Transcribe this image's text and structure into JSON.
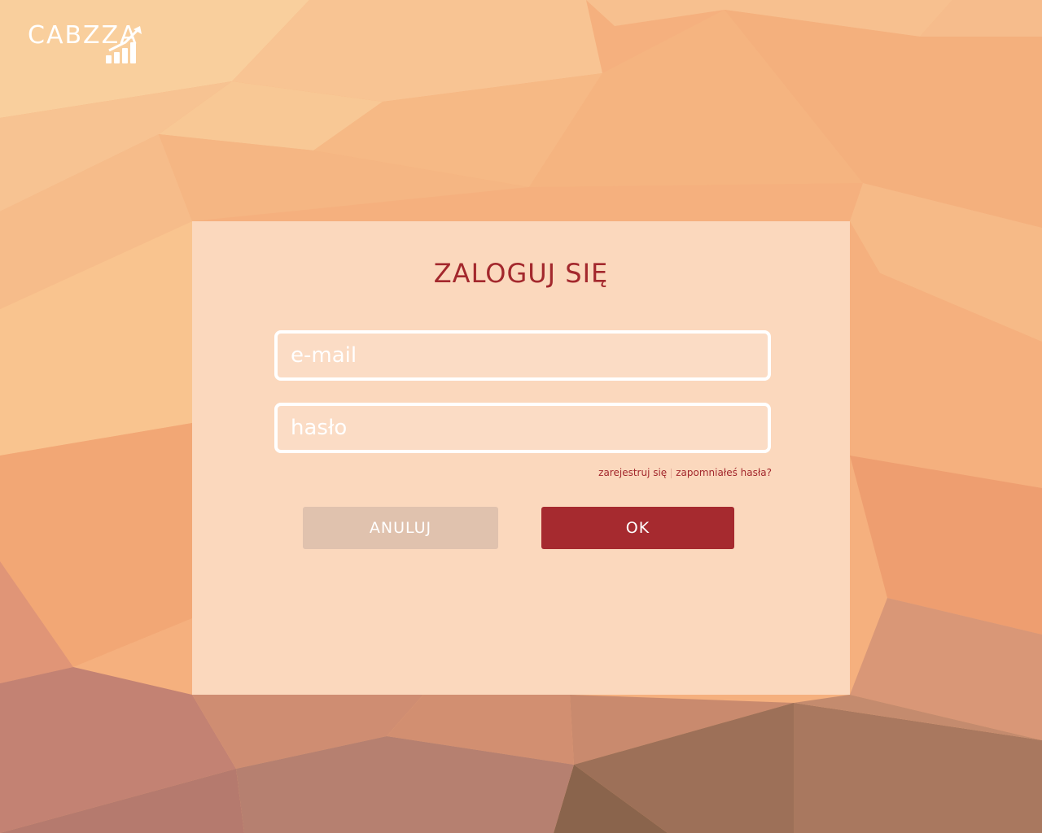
{
  "app": {
    "logo_text": "CABZZA"
  },
  "login": {
    "title": "ZALOGUJ SIĘ",
    "email_placeholder": "e-mail",
    "password_placeholder": "hasło",
    "register_link": "zarejestruj się",
    "forgot_link": "zapomniałeś hasła?",
    "cancel_label": "ANULUJ",
    "ok_label": "OK"
  },
  "colors": {
    "accent": "#a3282d",
    "ok_button": "#a62a2f",
    "cancel_button": "#e0c2ae"
  },
  "icons": {
    "logo_mark": "growth-chart-icon"
  }
}
